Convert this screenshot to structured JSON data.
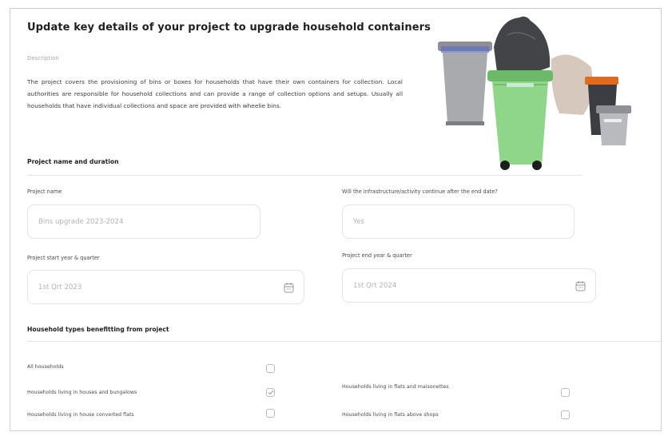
{
  "page": {
    "title": "Update key details of your project to upgrade household containers",
    "description_label": "Description",
    "description": "The project covers the provisioning of bins or boxes for households that have their own containers for collection. Local authorities are responsible for household collections and can provide a range of collection options and setups. Usually all households that have individual collections and space are provided with wheelie bins."
  },
  "project_section": {
    "heading": "Project name and duration",
    "project_name": {
      "label": "Project name",
      "value": "Bins upgrade 2023-2024"
    },
    "continue_field": {
      "label": "Will the infrastructure/activity continue after the end date?",
      "value": "Yes"
    },
    "start": {
      "label": "Project start year & quarter",
      "value": "1st Qrt 2023",
      "icon": "calendar-icon"
    },
    "end": {
      "label": "Project end year & quarter",
      "value": "1st Qrt 2024",
      "icon": "calendar-icon"
    }
  },
  "household_section": {
    "heading": "Household types benefitting from project",
    "items": [
      {
        "label": "All households",
        "checked": false
      },
      {
        "label": "Households living in houses and bungalows",
        "checked": true
      },
      {
        "label": "Households living in flats and maisonettes",
        "checked": false
      },
      {
        "label": "Households living in house converted flats",
        "checked": false
      },
      {
        "label": "Households living in flats above shops",
        "checked": false
      }
    ]
  },
  "colors": {
    "green_bin": "#8fd58a",
    "grey_bin": "#a9aaae",
    "orange_lid": "#e26a1e",
    "dark_bin": "#3b3d42",
    "border": "#e4e4e4"
  }
}
